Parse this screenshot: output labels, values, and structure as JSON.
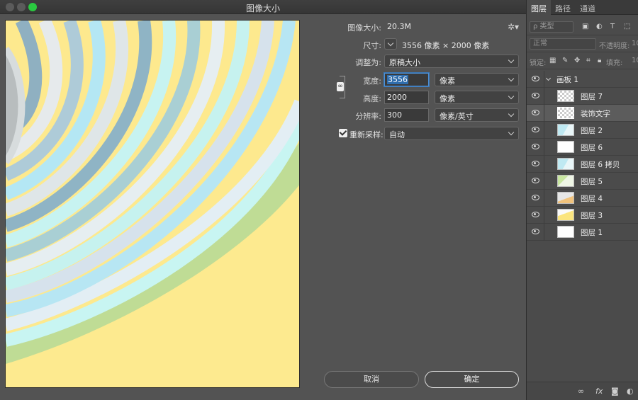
{
  "dialog": {
    "title": "图像大小",
    "image_size_label": "图像大小:",
    "image_size_value": "20.3M",
    "dimensions_label": "尺寸:",
    "dimensions_value": "3556 像素 × 2000 像素",
    "fit_to_label": "调整为:",
    "fit_to_value": "原稿大小",
    "width_label": "宽度:",
    "width_value": "3556",
    "width_unit": "像素",
    "height_label": "高度:",
    "height_value": "2000",
    "height_unit": "像素",
    "resolution_label": "分辨率:",
    "resolution_value": "300",
    "resolution_unit": "像素/英寸",
    "resample_label": "重新采样:",
    "resample_checked": true,
    "resample_value": "自动",
    "cancel_label": "取消",
    "ok_label": "确定"
  },
  "layers_panel": {
    "tabs": [
      "图层",
      "路径",
      "通道"
    ],
    "filter_placeholder": "ρ 类型",
    "blend_mode": "正常",
    "opacity_label": "不透明度:",
    "opacity_value": "10",
    "lock_label": "锁定:",
    "fill_label": "填充:",
    "fill_value": "10",
    "group_name": "画板 1",
    "layers": [
      {
        "name": "图层 7",
        "thumb": "checker"
      },
      {
        "name": "装饰文字",
        "thumb": "checker"
      },
      {
        "name": "图层 2",
        "thumb": "blue"
      },
      {
        "name": "图层 6",
        "thumb": "white"
      },
      {
        "name": "图层 6 拷贝",
        "thumb": "blue"
      },
      {
        "name": "图层 5",
        "thumb": "green"
      },
      {
        "name": "图层 4",
        "thumb": "orange"
      },
      {
        "name": "图层 3",
        "thumb": "yellow"
      },
      {
        "name": "图层 1",
        "thumb": "white"
      }
    ],
    "selected_layer": "装饰文字"
  },
  "colors": {
    "accent": "#2f6dad",
    "close_dot": "#5b5b5b",
    "zoom_dot": "#2ac940"
  }
}
